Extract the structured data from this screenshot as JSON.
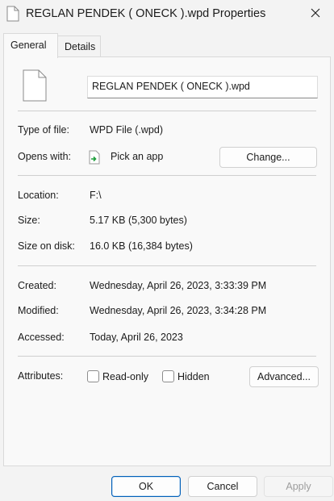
{
  "window": {
    "title": "REGLAN PENDEK ( ONECK ).wpd Properties"
  },
  "tabs": [
    {
      "label": "General"
    },
    {
      "label": "Details"
    }
  ],
  "filename": "REGLAN PENDEK ( ONECK ).wpd",
  "type_of_file": {
    "label": "Type of file:",
    "value": "WPD File (.wpd)"
  },
  "opens_with": {
    "label": "Opens with:",
    "app": "Pick an app",
    "change_label": "Change..."
  },
  "location": {
    "label": "Location:",
    "value": "F:\\"
  },
  "size": {
    "label": "Size:",
    "value": "5.17 KB (5,300 bytes)"
  },
  "size_on_disk": {
    "label": "Size on disk:",
    "value": "16.0 KB (16,384 bytes)"
  },
  "created": {
    "label": "Created:",
    "value": "Wednesday, April 26, 2023, 3:33:39 PM"
  },
  "modified": {
    "label": "Modified:",
    "value": "Wednesday, April 26, 2023, 3:34:28 PM"
  },
  "accessed": {
    "label": "Accessed:",
    "value": "Today, April 26, 2023"
  },
  "attributes": {
    "label": "Attributes:",
    "readonly_label": "Read-only",
    "readonly_checked": false,
    "hidden_label": "Hidden",
    "hidden_checked": false,
    "advanced_label": "Advanced..."
  },
  "footer": {
    "ok": "OK",
    "cancel": "Cancel",
    "apply": "Apply"
  },
  "colors": {
    "accent": "#005fb8",
    "panel": "#f9f9f9",
    "window": "#f3f3f3"
  }
}
